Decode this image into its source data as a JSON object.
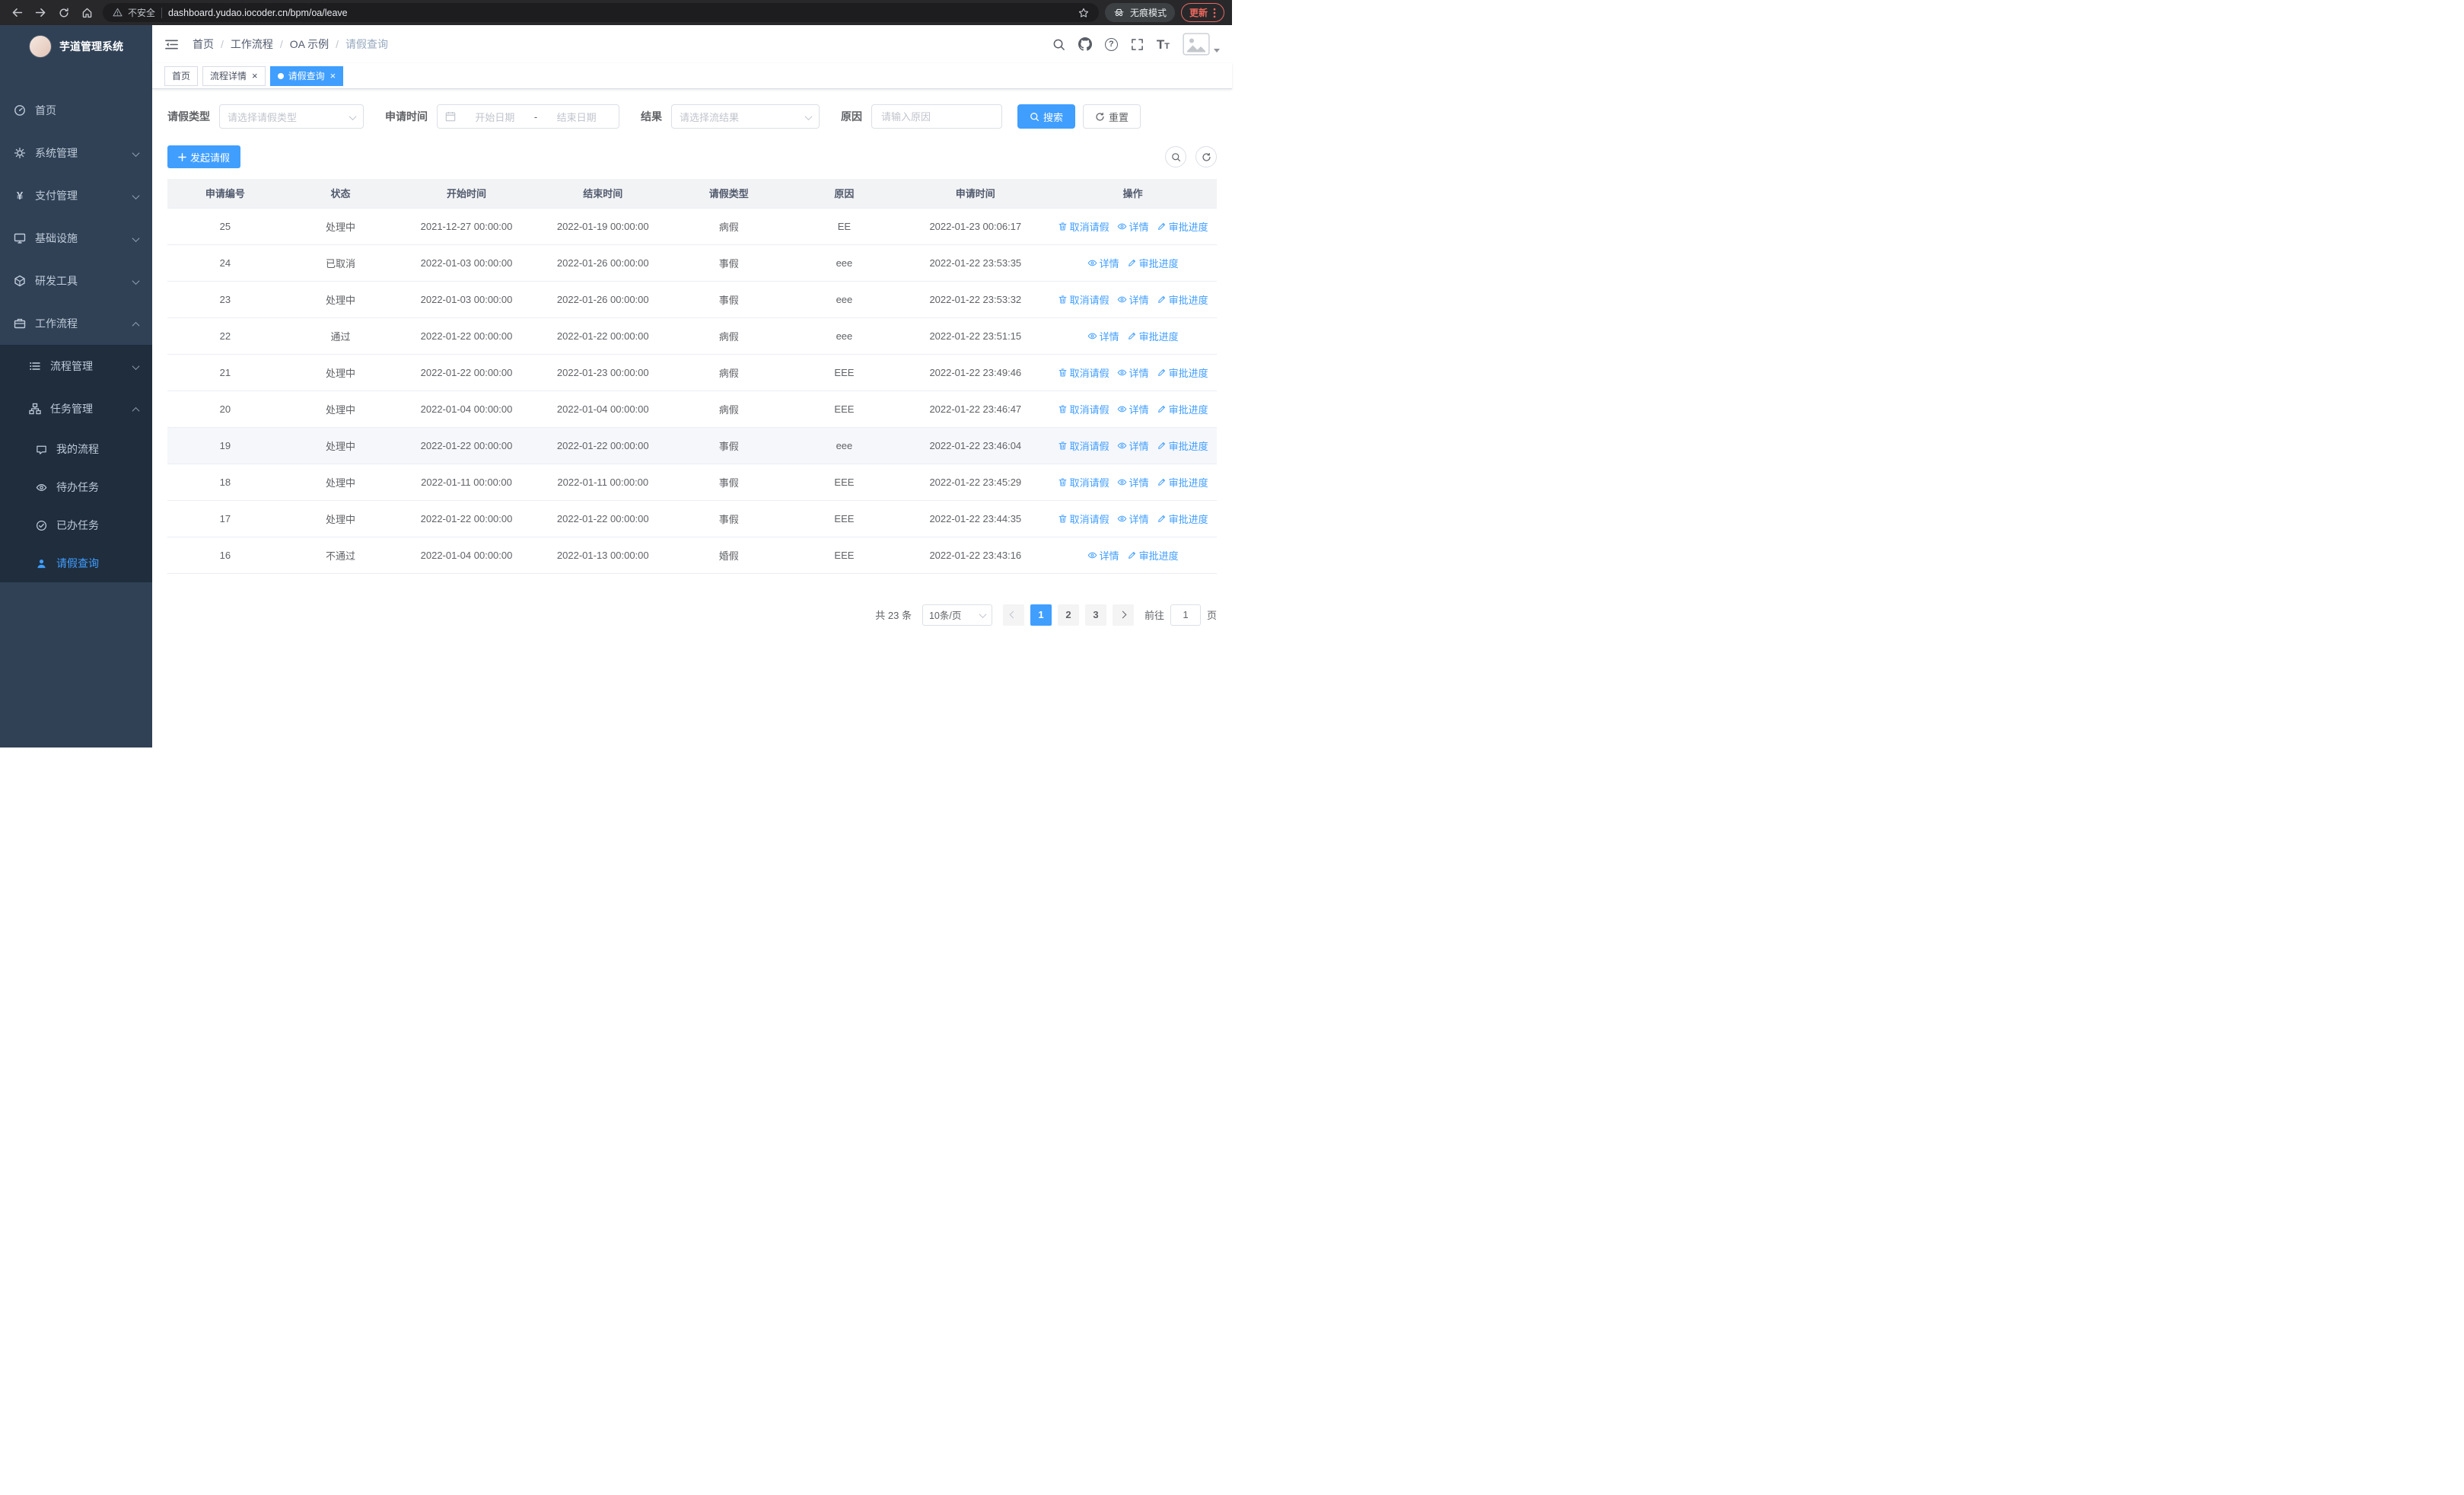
{
  "browser": {
    "warning_label": "不安全",
    "url": "dashboard.yudao.iocoder.cn/bpm/oa/leave",
    "incognito_label": "无痕模式",
    "update_label": "更新"
  },
  "sidebar": {
    "title": "芋道管理系统",
    "items": [
      {
        "label": "首页"
      },
      {
        "label": "系统管理"
      },
      {
        "label": "支付管理"
      },
      {
        "label": "基础设施"
      },
      {
        "label": "研发工具"
      },
      {
        "label": "工作流程"
      }
    ],
    "workflow_children": [
      {
        "label": "流程管理"
      },
      {
        "label": "任务管理"
      }
    ],
    "task_children": [
      {
        "label": "我的流程"
      },
      {
        "label": "待办任务"
      },
      {
        "label": "已办任务"
      },
      {
        "label": "请假查询"
      }
    ]
  },
  "header": {
    "breadcrumb": [
      "首页",
      "工作流程",
      "OA 示例",
      "请假查询"
    ],
    "breadcrumb_separator": "/"
  },
  "tabs": [
    {
      "label": "首页"
    },
    {
      "label": "流程详情"
    },
    {
      "label": "请假查询"
    }
  ],
  "filters": {
    "leave_type_label": "请假类型",
    "leave_type_placeholder": "请选择请假类型",
    "apply_time_label": "申请时间",
    "start_date_placeholder": "开始日期",
    "range_separator": "-",
    "end_date_placeholder": "结束日期",
    "result_label": "结果",
    "result_placeholder": "请选择流结果",
    "reason_label": "原因",
    "reason_placeholder": "请输入原因",
    "search_label": "搜索",
    "reset_label": "重置"
  },
  "toolbar": {
    "create_label": "发起请假"
  },
  "table": {
    "columns": [
      "申请编号",
      "状态",
      "开始时间",
      "结束时间",
      "请假类型",
      "原因",
      "申请时间",
      "操作"
    ],
    "action_labels": {
      "cancel": "取消请假",
      "detail": "详情",
      "progress": "审批进度"
    },
    "rows": [
      {
        "id": "25",
        "status": "处理中",
        "start": "2021-12-27 00:00:00",
        "end": "2022-01-19 00:00:00",
        "type": "病假",
        "reason": "EE",
        "apply_time": "2022-01-23 00:06:17",
        "actions": [
          "cancel",
          "detail",
          "progress"
        ],
        "highlighted": false
      },
      {
        "id": "24",
        "status": "已取消",
        "start": "2022-01-03 00:00:00",
        "end": "2022-01-26 00:00:00",
        "type": "事假",
        "reason": "eee",
        "apply_time": "2022-01-22 23:53:35",
        "actions": [
          "detail",
          "progress"
        ],
        "highlighted": false
      },
      {
        "id": "23",
        "status": "处理中",
        "start": "2022-01-03 00:00:00",
        "end": "2022-01-26 00:00:00",
        "type": "事假",
        "reason": "eee",
        "apply_time": "2022-01-22 23:53:32",
        "actions": [
          "cancel",
          "detail",
          "progress"
        ],
        "highlighted": false
      },
      {
        "id": "22",
        "status": "通过",
        "start": "2022-01-22 00:00:00",
        "end": "2022-01-22 00:00:00",
        "type": "病假",
        "reason": "eee",
        "apply_time": "2022-01-22 23:51:15",
        "actions": [
          "detail",
          "progress"
        ],
        "highlighted": false
      },
      {
        "id": "21",
        "status": "处理中",
        "start": "2022-01-22 00:00:00",
        "end": "2022-01-23 00:00:00",
        "type": "病假",
        "reason": "EEE",
        "apply_time": "2022-01-22 23:49:46",
        "actions": [
          "cancel",
          "detail",
          "progress"
        ],
        "highlighted": false
      },
      {
        "id": "20",
        "status": "处理中",
        "start": "2022-01-04 00:00:00",
        "end": "2022-01-04 00:00:00",
        "type": "病假",
        "reason": "EEE",
        "apply_time": "2022-01-22 23:46:47",
        "actions": [
          "cancel",
          "detail",
          "progress"
        ],
        "highlighted": false
      },
      {
        "id": "19",
        "status": "处理中",
        "start": "2022-01-22 00:00:00",
        "end": "2022-01-22 00:00:00",
        "type": "事假",
        "reason": "eee",
        "apply_time": "2022-01-22 23:46:04",
        "actions": [
          "cancel",
          "detail",
          "progress"
        ],
        "highlighted": true
      },
      {
        "id": "18",
        "status": "处理中",
        "start": "2022-01-11 00:00:00",
        "end": "2022-01-11 00:00:00",
        "type": "事假",
        "reason": "EEE",
        "apply_time": "2022-01-22 23:45:29",
        "actions": [
          "cancel",
          "detail",
          "progress"
        ],
        "highlighted": false
      },
      {
        "id": "17",
        "status": "处理中",
        "start": "2022-01-22 00:00:00",
        "end": "2022-01-22 00:00:00",
        "type": "事假",
        "reason": "EEE",
        "apply_time": "2022-01-22 23:44:35",
        "actions": [
          "cancel",
          "detail",
          "progress"
        ],
        "highlighted": false
      },
      {
        "id": "16",
        "status": "不通过",
        "start": "2022-01-04 00:00:00",
        "end": "2022-01-13 00:00:00",
        "type": "婚假",
        "reason": "EEE",
        "apply_time": "2022-01-22 23:43:16",
        "actions": [
          "detail",
          "progress"
        ],
        "highlighted": false
      }
    ]
  },
  "pagination": {
    "total_label": "共 23 条",
    "page_size_label": "10条/页",
    "pages": [
      "1",
      "2",
      "3"
    ],
    "goto_label": "前往",
    "goto_value": "1",
    "goto_unit": "页"
  },
  "ui": {
    "close_glyph": "×",
    "question_glyph": "?",
    "yen_glyph": "¥",
    "font_size_glyph_big": "T",
    "font_size_glyph_small": "T"
  },
  "colors": {
    "primary": "#409eff",
    "sidebar_bg": "#304156",
    "sidebar_submenu_bg": "#1f2d3d"
  }
}
